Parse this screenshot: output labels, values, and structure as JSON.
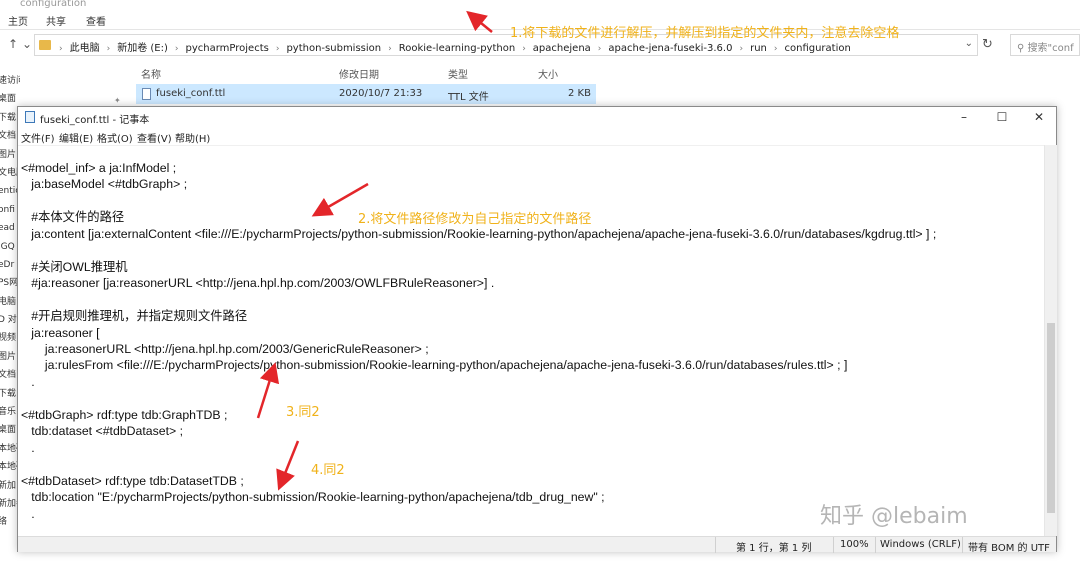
{
  "explorer": {
    "title": "configuration",
    "ribbon_tabs": [
      "主页",
      "共享",
      "查看"
    ],
    "breadcrumbs": [
      "此电脑",
      "新加卷 (E:)",
      "pycharmProjects",
      "python-submission",
      "Rookie-learning-python",
      "apachejena",
      "apache-jena-fuseki-3.6.0",
      "run",
      "configuration"
    ],
    "search_placeholder": "搜索\"conf",
    "columns": {
      "name": "名称",
      "date": "修改日期",
      "type": "类型",
      "size": "大小"
    },
    "file": {
      "name": "fuseki_conf.ttl",
      "date": "2020/10/7 21:33",
      "type": "TTL 文件",
      "size": "2 KB"
    },
    "sidebar_items": [
      "速访问",
      "桌面",
      "下载",
      "文档",
      "图片",
      "文电脑",
      "entic",
      "onfi",
      "ead",
      "IGQ",
      "eDr",
      "PS网",
      "电脑",
      "D 对",
      "视频",
      "图片",
      "文档",
      "下载",
      "音乐",
      "桌面",
      "本地磁",
      "本地磁",
      "新加",
      "新加卷",
      "络"
    ]
  },
  "notepad": {
    "title": "fuseki_conf.ttl - 记事本",
    "menu": [
      "文件(F)",
      "编辑(E)",
      "格式(O)",
      "查看(V)",
      "帮助(H)"
    ],
    "lines": [
      "<#model_inf> a ja:InfModel ;",
      "   ja:baseModel <#tdbGraph> ;",
      "",
      "   #本体文件的路径",
      "   ja:content [ja:externalContent <file:///E:/pycharmProjects/python-submission/Rookie-learning-python/apachejena/apache-jena-fuseki-3.6.0/run/databases/kgdrug.ttl> ] ;",
      "",
      "   #关闭OWL推理机",
      "   #ja:reasoner [ja:reasonerURL <http://jena.hpl.hp.com/2003/OWLFBRuleReasoner>] .",
      "",
      "   #开启规则推理机，并指定规则文件路径",
      "   ja:reasoner [",
      "       ja:reasonerURL <http://jena.hpl.hp.com/2003/GenericRuleReasoner> ;",
      "       ja:rulesFrom <file:///E:/pycharmProjects/python-submission/Rookie-learning-python/apachejena/apache-jena-fuseki-3.6.0/run/databases/rules.ttl> ; ]",
      "   .",
      "",
      "<#tdbGraph> rdf:type tdb:GraphTDB ;",
      "   tdb:dataset <#tdbDataset> ;",
      "   .",
      "",
      "<#tdbDataset> rdf:type tdb:DatasetTDB ;",
      "   tdb:location \"E:/pycharmProjects/python-submission/Rookie-learning-python/apachejena/tdb_drug_new\" ;",
      "   ."
    ],
    "status": {
      "position": "第 1 行，第 1 列",
      "zoom": "100%",
      "eol": "Windows (CRLF)",
      "encoding": "带有 BOM 的 UTF"
    }
  },
  "annotations": {
    "a1": "1.将下载的文件进行解压，并解压到指定的文件夹内，注意去除空格",
    "a2": "2.将文件路径修改为自己指定的文件路径",
    "a3": "3.同2",
    "a4": "4.同2",
    "color": "#f0b21a"
  },
  "watermark": "知乎 @lebaim"
}
